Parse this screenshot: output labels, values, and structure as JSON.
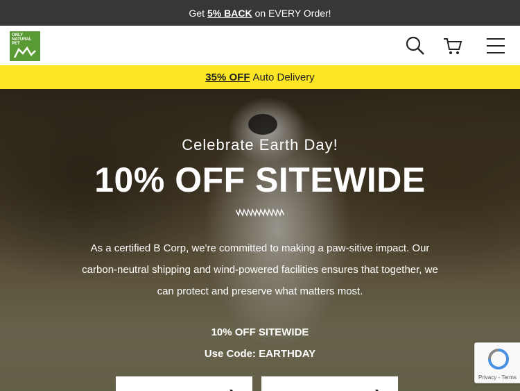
{
  "announcement": {
    "prefix": "Get",
    "highlight": "5% BACK",
    "suffix": "on EVERY Order!"
  },
  "logo": {
    "text": "ONLY NATURAL PET"
  },
  "header": {
    "icons": [
      "search-icon",
      "cart-icon",
      "menu-icon"
    ]
  },
  "promo_bar": {
    "highlight": "35% OFF",
    "text": "Auto Delivery"
  },
  "hero": {
    "eyebrow": "Celebrate Earth Day!",
    "headline": "10% OFF SITEWIDE",
    "body": "As a certified B Corp, we're committed to making a paw-sitive impact. Our carbon-neutral shipping and wind-powered facilities ensures that together, we can protect and preserve what matters most.",
    "offer_line1": "10% OFF SITEWIDE",
    "offer_line2": "Use Code: EARTHDAY"
  },
  "recaptcha": {
    "text": "Privacy - Terms"
  },
  "colors": {
    "topbar": "#353738",
    "promo": "#fde725",
    "logo": "#5a9b35"
  }
}
